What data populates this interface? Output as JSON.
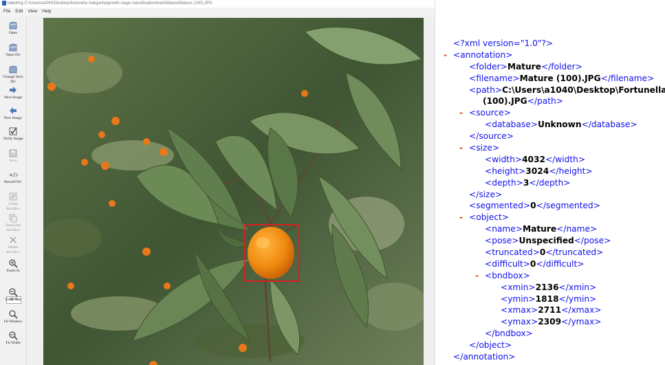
{
  "window": {
    "title": "labelImg C:\\Users\\a1040\\Desktop\\fortunella margarita\\growth stage classification\\train\\Mature\\Mature (100).JPG",
    "menu": [
      "File",
      "Edit",
      "View",
      "Help"
    ]
  },
  "toolbar": {
    "open": "Open",
    "open_dir": "Open Dir",
    "change_save_dir": "Change Save Dir",
    "next_image": "Next Image",
    "prev_image": "Prev Image",
    "verify_image": "Verify Image",
    "save": "Save",
    "format": "PascalVOC",
    "create_rectbox": "Create\nRectBox",
    "duplicate_rectbox": "Duplicate\nRectBox",
    "delete_rectbox": "Delete\nRectBox",
    "zoom_in": "Zoom In",
    "zoom_value": "32 %",
    "zoom_out": "Zoom Out",
    "fit_window": "Fit Window",
    "fit_width": "Fit Width"
  },
  "canvas": {
    "box_color": "#d62020"
  },
  "xml": {
    "declaration": "<?xml version=\"1.0\"?>",
    "annotation_open": "<annotation>",
    "folder": {
      "open": "<folder>",
      "value": "Mature",
      "close": "</folder>"
    },
    "filename": {
      "open": "<filename>",
      "value": "Mature (100).JPG",
      "close": "</filename>"
    },
    "path": {
      "open": "<path>",
      "value_line1": "C:\\Users\\a1040\\Desktop\\Fortunella",
      "value_line2": "(100).JPG",
      "close": "</path>"
    },
    "source_open": "<source>",
    "database": {
      "open": "<database>",
      "value": "Unknown",
      "close": "</database>"
    },
    "source_close": "</source>",
    "size_open": "<size>",
    "width": {
      "open": "<width>",
      "value": "4032",
      "close": "</width>"
    },
    "height": {
      "open": "<height>",
      "value": "3024",
      "close": "</height>"
    },
    "depth": {
      "open": "<depth>",
      "value": "3",
      "close": "</depth>"
    },
    "size_close": "</size>",
    "segmented": {
      "open": "<segmented>",
      "value": "0",
      "close": "</segmented>"
    },
    "object_open": "<object>",
    "name": {
      "open": "<name>",
      "value": "Mature",
      "close": "</name>"
    },
    "pose": {
      "open": "<pose>",
      "value": "Unspecified",
      "close": "</pose>"
    },
    "truncated": {
      "open": "<truncated>",
      "value": "0",
      "close": "</truncated>"
    },
    "difficult": {
      "open": "<difficult>",
      "value": "0",
      "close": "</difficult>"
    },
    "bndbox_open": "<bndbox>",
    "xmin": {
      "open": "<xmin>",
      "value": "2136",
      "close": "</xmin>"
    },
    "ymin": {
      "open": "<ymin>",
      "value": "1818",
      "close": "</ymin>"
    },
    "xmax": {
      "open": "<xmax>",
      "value": "2711",
      "close": "</xmax>"
    },
    "ymax": {
      "open": "<ymax>",
      "value": "2309",
      "close": "</ymax>"
    },
    "bndbox_close": "</bndbox>",
    "object_close": "</object>",
    "annotation_close": "</annotation>",
    "collapse_marker": "-"
  }
}
